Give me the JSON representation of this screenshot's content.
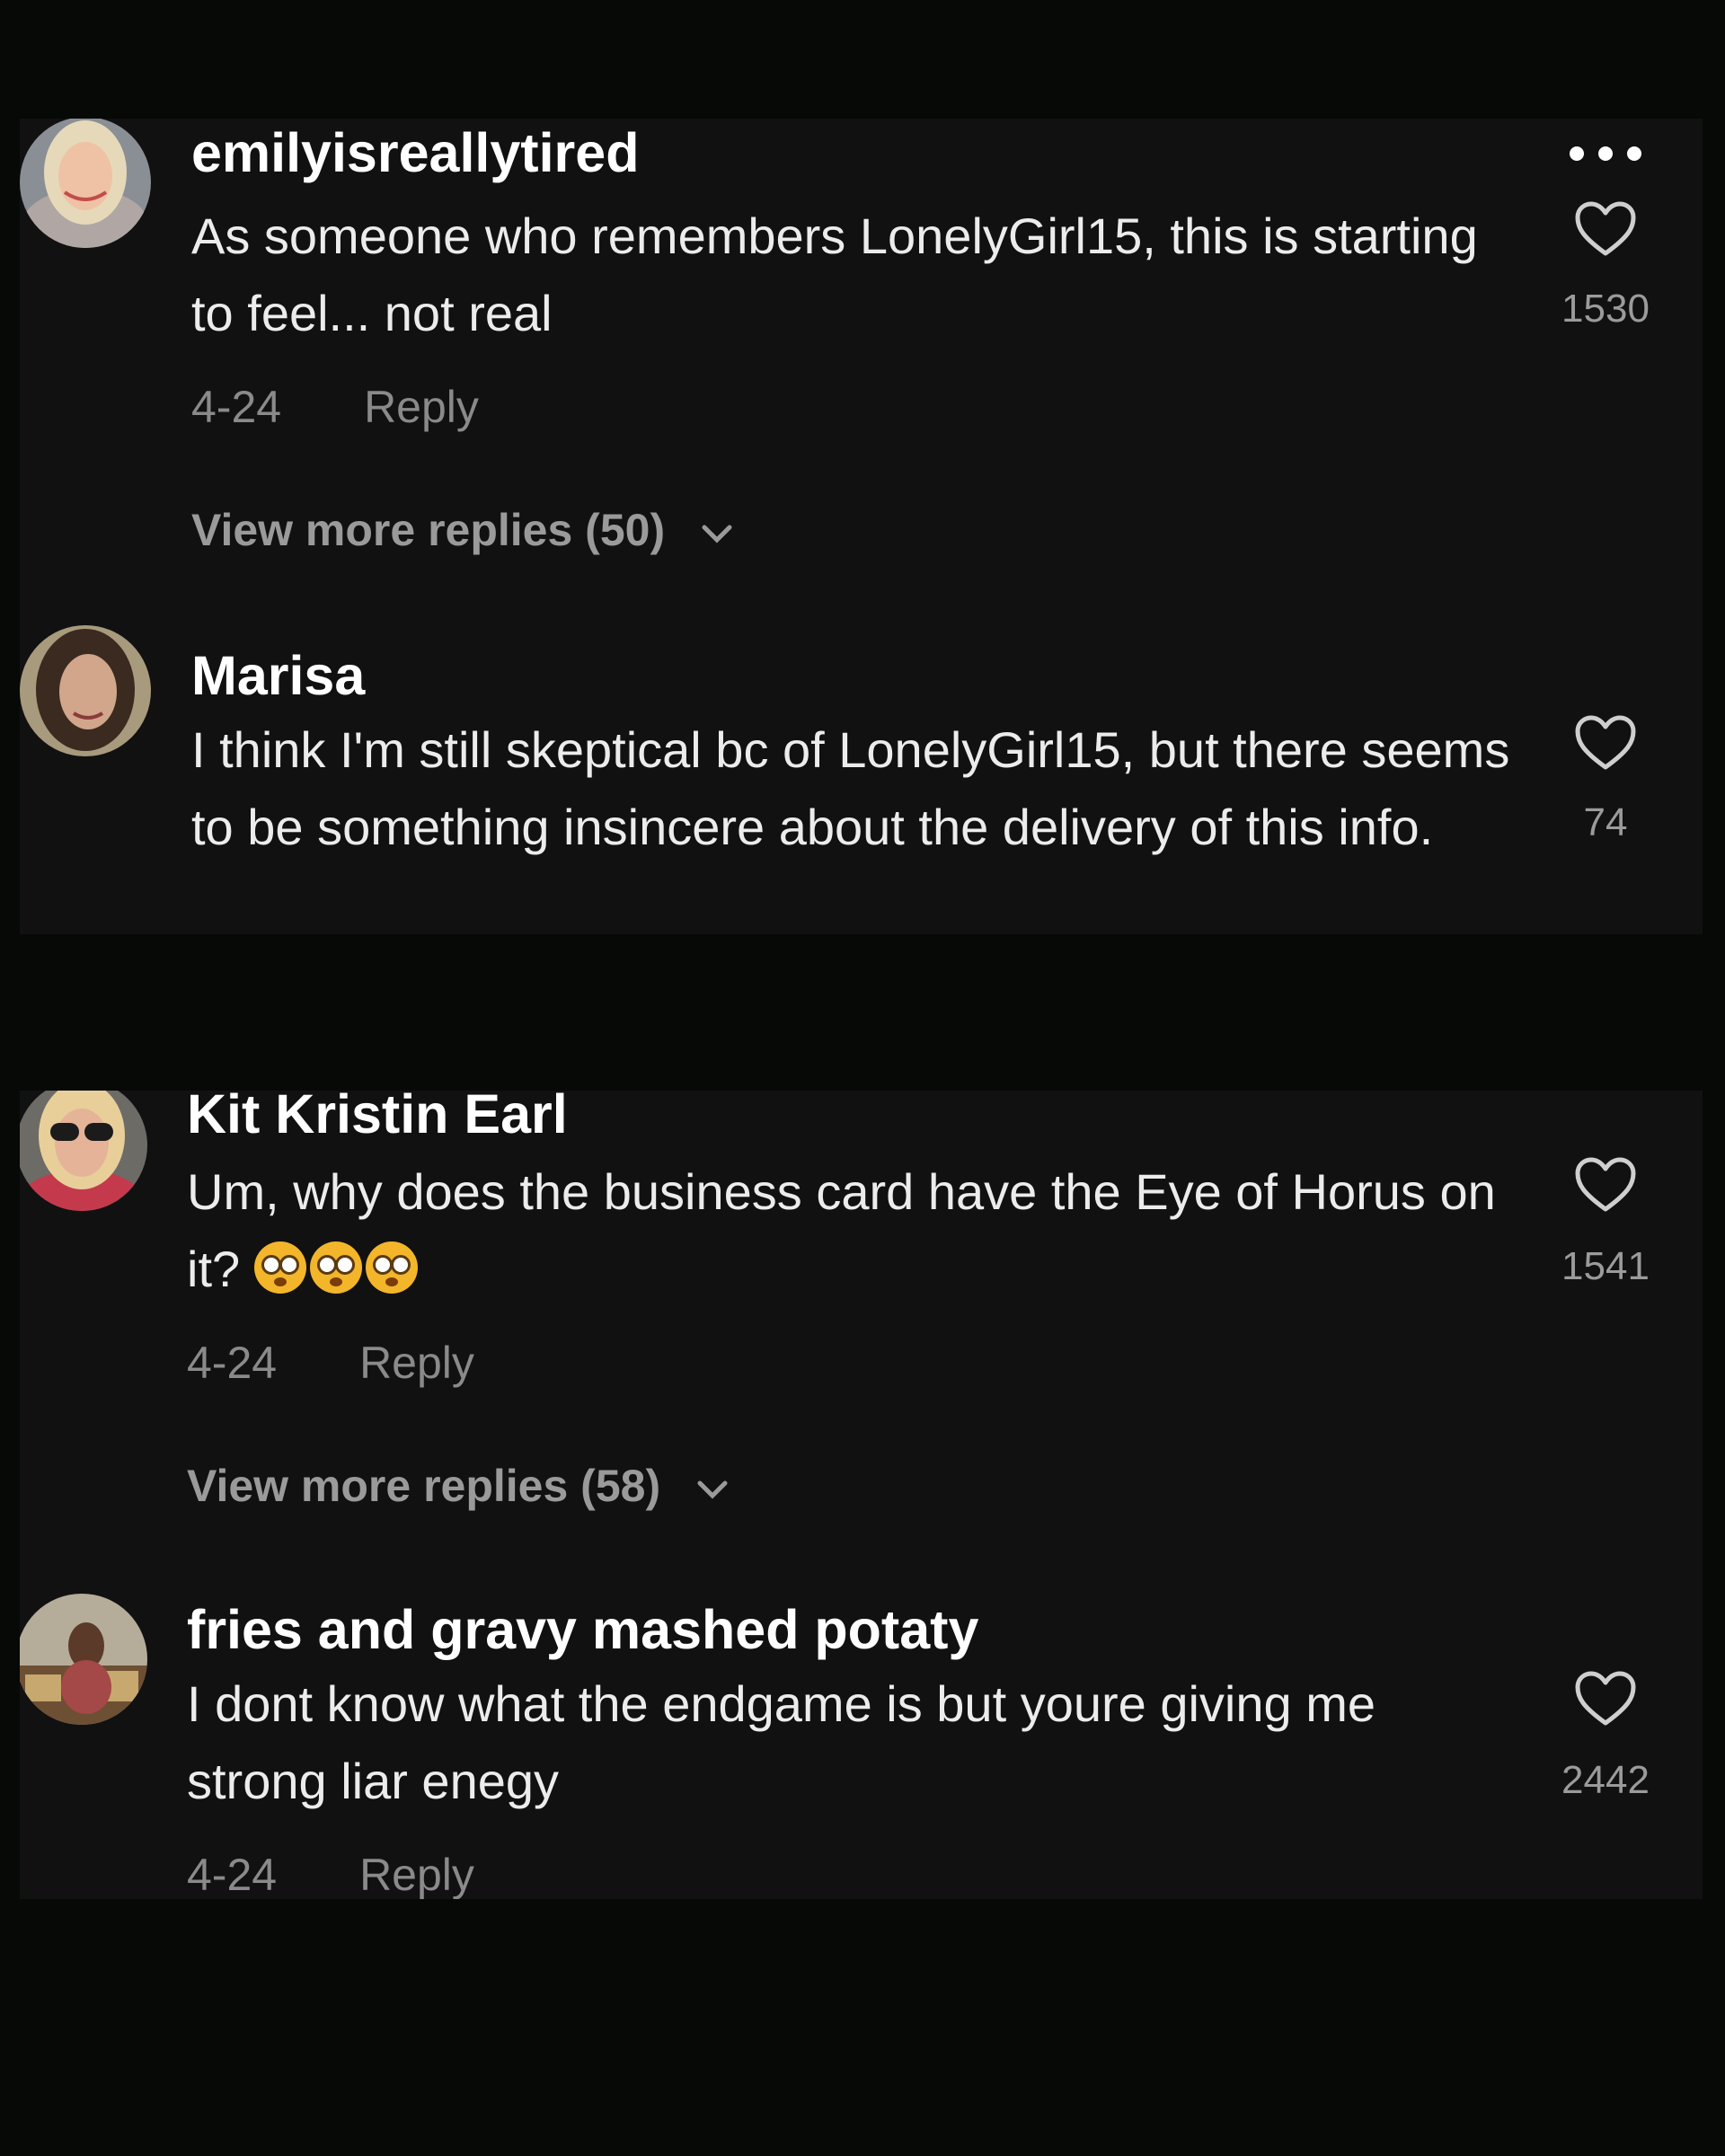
{
  "comments": [
    {
      "username": "emilyisreallytired",
      "text": "As someone who remembers LonelyGirl15, this is starting to feel... not real",
      "date": "4-24",
      "reply": "Reply",
      "likes": "1530",
      "more_replies": "View more replies (50)"
    },
    {
      "username": "Marisa",
      "text": "I think I'm still skeptical bc of LonelyGirl15, but there seems to be something insincere about the delivery of this info.",
      "likes": "74"
    },
    {
      "username": "Kit Kristin Earl",
      "text": "Um, why does the business card have the Eye of Horus on it?",
      "emoji": "flushed-face x3",
      "date": "4-24",
      "reply": "Reply",
      "likes": "1541",
      "more_replies": "View more replies (58)"
    },
    {
      "username": "fries and gravy mashed potaty",
      "text": "I dont know what the endgame is but youre giving me strong liar enegy",
      "date": "4-24",
      "reply": "Reply",
      "likes": "2442"
    }
  ],
  "icons": {
    "heart": "heart-outline-icon",
    "more": "more-options-icon",
    "chevron": "chevron-down-icon"
  },
  "colors": {
    "background": "#060906",
    "panel": "#111112",
    "username": "#ffffff",
    "text": "#ececec",
    "meta": "#8a8a8a"
  }
}
